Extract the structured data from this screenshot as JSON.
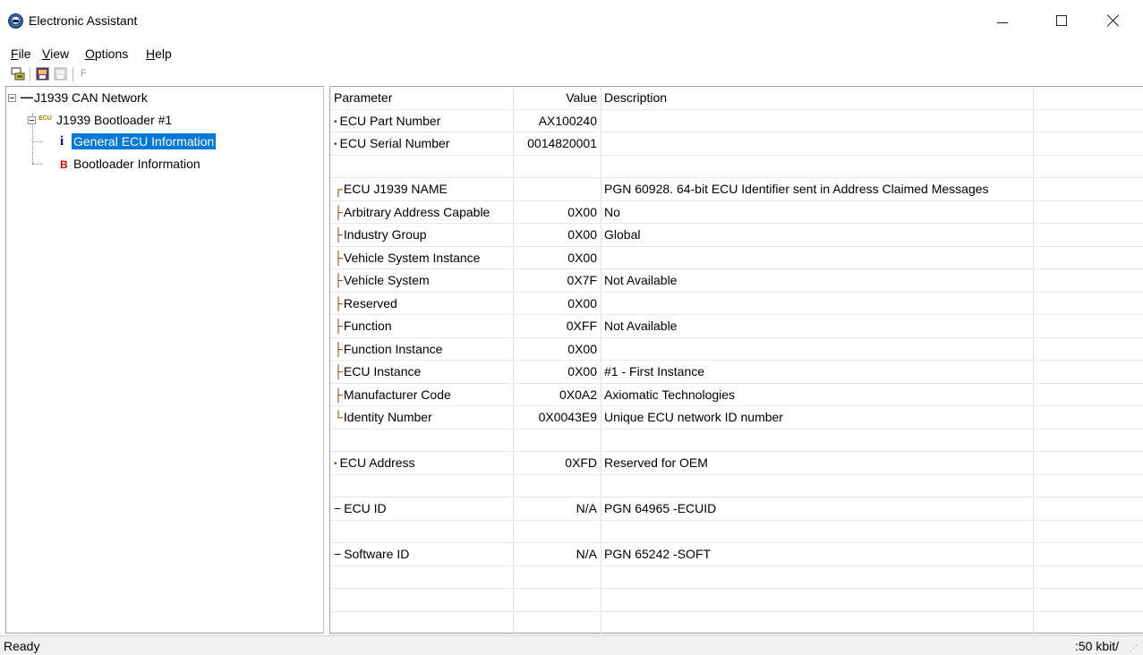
{
  "window": {
    "title": "Electronic Assistant"
  },
  "menu": {
    "file": {
      "first": "F",
      "rest": "ile"
    },
    "view": {
      "first": "V",
      "rest": "iew"
    },
    "options": {
      "first": "O",
      "rest": "ptions"
    },
    "help": {
      "first": "H",
      "rest": "elp"
    }
  },
  "toolbar": {
    "f_label": "F"
  },
  "tree": {
    "root": "J1939 CAN Network",
    "ecu_badge": "ECU",
    "bootloader": "J1939 Bootloader #1",
    "general_icon": "i",
    "general": "General ECU Information",
    "bootinfo_icon": "B",
    "bootinfo": "Bootloader Information"
  },
  "grid": {
    "headers": {
      "parameter": "Parameter",
      "value": "Value",
      "description": "Description"
    },
    "rows": [
      {
        "marker": "•",
        "param": "ECU Part Number",
        "value": "AX100240",
        "desc": ""
      },
      {
        "marker": "•",
        "param": "ECU Serial Number",
        "value": "0014820001",
        "desc": ""
      },
      {
        "marker": "",
        "param": "",
        "value": "",
        "desc": ""
      },
      {
        "marker": "┌",
        "param": "ECU J1939 NAME",
        "value": "",
        "desc": "PGN 60928. 64-bit ECU Identifier sent in Address Claimed Messages"
      },
      {
        "marker": "├",
        "param": "Arbitrary Address Capable",
        "value": "0X00",
        "desc": "No"
      },
      {
        "marker": "├",
        "param": "Industry Group",
        "value": "0X00",
        "desc": "Global"
      },
      {
        "marker": "├",
        "param": "Vehicle System Instance",
        "value": "0X00",
        "desc": ""
      },
      {
        "marker": "├",
        "param": "Vehicle System",
        "value": "0X7F",
        "desc": "Not Available"
      },
      {
        "marker": "├",
        "param": "Reserved",
        "value": "0X00",
        "desc": ""
      },
      {
        "marker": "├",
        "param": "Function",
        "value": "0XFF",
        "desc": "Not Available"
      },
      {
        "marker": "├",
        "param": "Function Instance",
        "value": "0X00",
        "desc": ""
      },
      {
        "marker": "├",
        "param": "ECU Instance",
        "value": "0X00",
        "desc": "#1 - First Instance"
      },
      {
        "marker": "├",
        "param": "Manufacturer Code",
        "value": "0X0A2",
        "desc": "Axiomatic Technologies"
      },
      {
        "marker": "└",
        "param": "Identity Number",
        "value": "0X0043E9",
        "desc": "Unique ECU network ID number"
      },
      {
        "marker": "",
        "param": "",
        "value": "",
        "desc": ""
      },
      {
        "marker": "•",
        "param": "ECU Address",
        "value": "0XFD",
        "desc": "Reserved for OEM"
      },
      {
        "marker": "",
        "param": "",
        "value": "",
        "desc": ""
      },
      {
        "marker": "−",
        "param": "ECU ID",
        "value": "N/A",
        "desc": "PGN 64965   -ECUID"
      },
      {
        "marker": "",
        "param": "",
        "value": "",
        "desc": ""
      },
      {
        "marker": "−",
        "param": "Software ID",
        "value": "N/A",
        "desc": "PGN 65242   -SOFT"
      },
      {
        "marker": "",
        "param": "",
        "value": "",
        "desc": ""
      },
      {
        "marker": "",
        "param": "",
        "value": "",
        "desc": ""
      },
      {
        "marker": "",
        "param": "",
        "value": "",
        "desc": ""
      }
    ]
  },
  "status": {
    "left": "Ready",
    "right": ":50 kbit/"
  },
  "colors": {
    "selection": "#0078d7",
    "bullet": "#7a1f6e",
    "branch": "#8b4513"
  }
}
